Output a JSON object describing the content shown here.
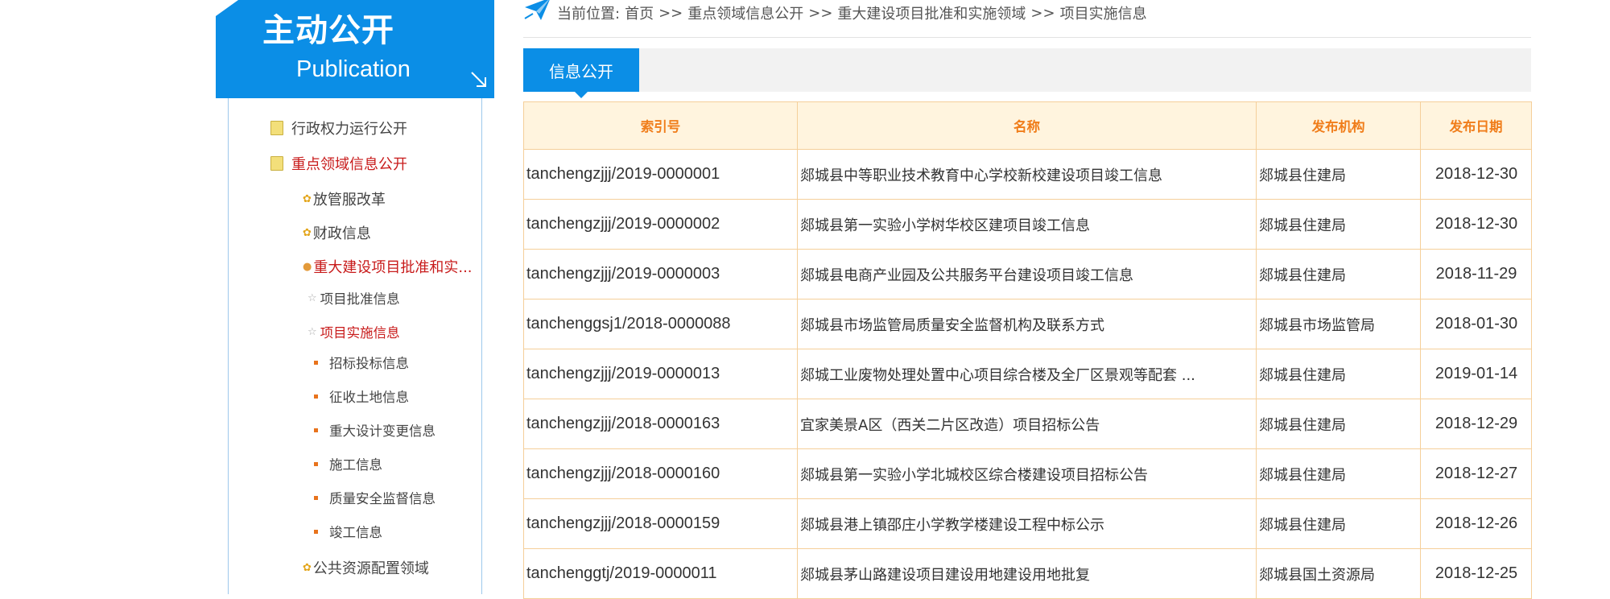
{
  "sidebar": {
    "title": "主动公开",
    "subtitle": "Publication",
    "items": [
      {
        "label": "行政权力运行公开",
        "level": 1,
        "active": false
      },
      {
        "label": "重点领域信息公开",
        "level": 1,
        "active": true
      },
      {
        "label": "放管服改革",
        "level": 2,
        "active": false
      },
      {
        "label": "财政信息",
        "level": 2,
        "active": false
      },
      {
        "label": "重大建设项目批准和实...",
        "level": 2,
        "active": true
      },
      {
        "label": "项目批准信息",
        "level": 3,
        "active": false
      },
      {
        "label": "项目实施信息",
        "level": 3,
        "active": true
      },
      {
        "label": "招标投标信息",
        "level": 4,
        "active": false
      },
      {
        "label": "征收土地信息",
        "level": 4,
        "active": false
      },
      {
        "label": "重大设计变更信息",
        "level": 4,
        "active": false
      },
      {
        "label": "施工信息",
        "level": 4,
        "active": false
      },
      {
        "label": "质量安全监督信息",
        "level": 4,
        "active": false
      },
      {
        "label": "竣工信息",
        "level": 4,
        "active": false
      },
      {
        "label": "公共资源配置领域",
        "level": 2,
        "active": false
      }
    ]
  },
  "breadcrumb": {
    "prefix": "当前位置:",
    "items": [
      "首页",
      "重点领域信息公开",
      "重大建设项目批准和实施领域",
      "项目实施信息"
    ],
    "separator": ">>"
  },
  "tab": {
    "label": "信息公开"
  },
  "table": {
    "headers": [
      "索引号",
      "名称",
      "发布机构",
      "发布日期"
    ],
    "rows": [
      [
        "tanchengzjjj/2019-0000001",
        "郯城县中等职业技术教育中心学校新校建设项目竣工信息",
        "郯城县住建局",
        "2018-12-30"
      ],
      [
        "tanchengzjjj/2019-0000002",
        "郯城县第一实验小学树华校区建项目竣工信息",
        "郯城县住建局",
        "2018-12-30"
      ],
      [
        "tanchengzjjj/2019-0000003",
        "郯城县电商产业园及公共服务平台建设项目竣工信息",
        "郯城县住建局",
        "2018-11-29"
      ],
      [
        "tanchenggsj1/2018-0000088",
        "郯城县市场监管局质量安全监督机构及联系方式",
        "郯城县市场监管局",
        "2018-01-30"
      ],
      [
        "tanchengzjjj/2019-0000013",
        "郯城工业废物处理处置中心项目综合楼及全厂区景观等配套 ...",
        "郯城县住建局",
        "2019-01-14"
      ],
      [
        "tanchengzjjj/2018-0000163",
        "宜家美景A区（西关二片区改造）项目招标公告",
        "郯城县住建局",
        "2018-12-29"
      ],
      [
        "tanchengzjjj/2018-0000160",
        "郯城县第一实验小学北城校区综合楼建设项目招标公告",
        "郯城县住建局",
        "2018-12-27"
      ],
      [
        "tanchengzjjj/2018-0000159",
        "郯城县港上镇邵庄小学教学楼建设工程中标公示",
        "郯城县住建局",
        "2018-12-26"
      ],
      [
        "tanchenggtj/2019-0000011",
        "郯城县茅山路建设项目建设用地建设用地批复",
        "郯城县国土资源局",
        "2018-12-25"
      ]
    ]
  },
  "colors": {
    "brand_blue": "#0b8ee6",
    "header_orange": "#f07d1a",
    "active_red": "#c81b1b"
  },
  "icons": {
    "breadcrumb": "paper-plane-icon",
    "header_corner": "arrow-down-right-icon"
  }
}
